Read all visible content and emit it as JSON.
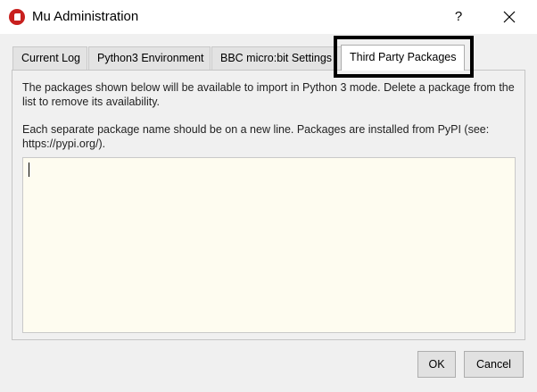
{
  "window": {
    "title": "Mu Administration",
    "help_label": "?",
    "icon": "mu-logo-icon",
    "close_icon": "close-icon"
  },
  "tabs": [
    {
      "label": "Current Log"
    },
    {
      "label": "Python3 Environment"
    },
    {
      "label": "BBC micro:bit Settings"
    },
    {
      "label": "Third Party Packages",
      "active": true
    }
  ],
  "panel": {
    "description_1": "The packages shown below will be available to import in Python 3 mode. Delete a package from the list to remove its availability.",
    "description_2": "Each separate package name should be on a new line. Packages are installed from PyPI (see: https://pypi.org/).",
    "packages_value": ""
  },
  "buttons": {
    "ok_label": "OK",
    "cancel_label": "Cancel"
  },
  "colors": {
    "editor_background": "#fefcf0",
    "highlight_border": "#000000",
    "brand_red": "#c8201e"
  }
}
